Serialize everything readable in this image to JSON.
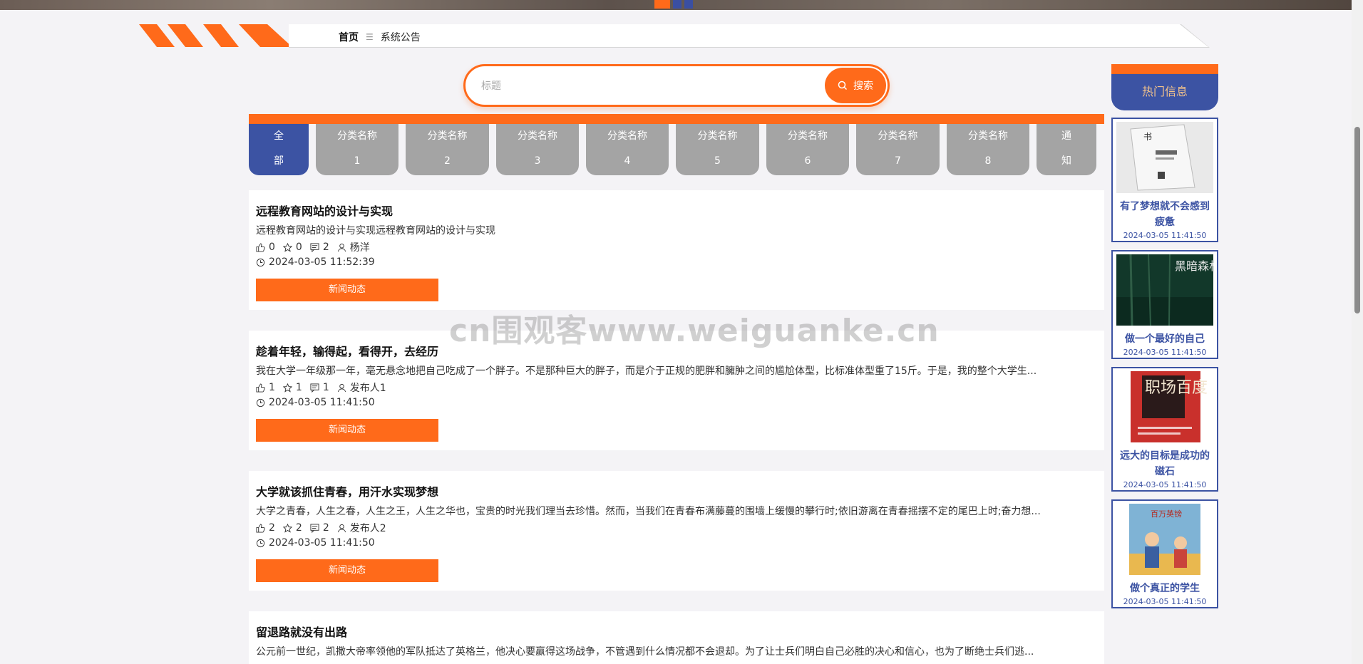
{
  "breadcrumb": {
    "home": "首页",
    "separator": "☰",
    "current": "系统公告"
  },
  "search": {
    "placeholder": "标题",
    "button_label": "搜索"
  },
  "categories": [
    {
      "label": "全\n部",
      "active": true
    },
    {
      "label": "分类名称\n1"
    },
    {
      "label": "分类名称\n2"
    },
    {
      "label": "分类名称\n3"
    },
    {
      "label": "分类名称\n4"
    },
    {
      "label": "分类名称\n5"
    },
    {
      "label": "分类名称\n6"
    },
    {
      "label": "分类名称\n7"
    },
    {
      "label": "分类名称\n8"
    },
    {
      "label": "通\n知"
    }
  ],
  "articles": [
    {
      "title": "远程教育网站的设计与实现",
      "desc": "远程教育网站的设计与实现远程教育网站的设计与实现",
      "likes": "0",
      "stars": "0",
      "comments": "2",
      "author": "杨洋",
      "time": "2024-03-05 11:52:39",
      "tag": "新闻动态"
    },
    {
      "title": "趁着年轻，输得起，看得开，去经历",
      "desc": "我在大学一年级那一年，毫无悬念地把自己吃成了一个胖子。不是那种巨大的胖子，而是介于正规的肥胖和臃肿之间的尴尬体型，比标准体型重了15斤。于是，我的整个大学生...",
      "likes": "1",
      "stars": "1",
      "comments": "1",
      "author": "发布人1",
      "time": "2024-03-05 11:41:50",
      "tag": "新闻动态"
    },
    {
      "title": "大学就该抓住青春，用汗水实现梦想",
      "desc": "大学之青春，人生之春，人生之王，人生之华也，宝贵的时光我们理当去珍惜。然而，当我们在青春布满藤蔓的围墙上缓慢的攀行时;依旧游离在青春摇摆不定的尾巴上时;奋力想...",
      "likes": "2",
      "stars": "2",
      "comments": "2",
      "author": "发布人2",
      "time": "2024-03-05 11:41:50",
      "tag": "新闻动态"
    },
    {
      "title": "留退路就没有出路",
      "desc": "公元前一世纪，凯撒大帝率领他的军队抵达了英格兰，他决心要赢得这场战争，不管遇到什么情况都不会退却。为了让士兵们明白自己必胜的决心和信心，也为了断绝士兵们逃...",
      "likes": "",
      "stars": "",
      "comments": "",
      "author": "",
      "time": "",
      "tag": ""
    }
  ],
  "hot": {
    "title": "热门信息",
    "items": [
      {
        "name": "有了梦想就不会感到疲惫",
        "date": "2024-03-05 11:41:50",
        "cover_text": ""
      },
      {
        "name": "做一个最好的自己",
        "date": "2024-03-05 11:41:50",
        "cover_text": "黑暗森林"
      },
      {
        "name": "远大的目标是成功的磁石",
        "date": "2024-03-05 11:41:50",
        "cover_text": "职场百度"
      },
      {
        "name": "做个真正的学生",
        "date": "2024-03-05 11:41:50",
        "cover_text": "百万英镑"
      }
    ]
  },
  "watermark": "cn围观客www.weiguanke.cn",
  "colors": {
    "accent": "#ff6a1a",
    "primary": "#3c53a3",
    "inactive": "#a4a4a4"
  }
}
